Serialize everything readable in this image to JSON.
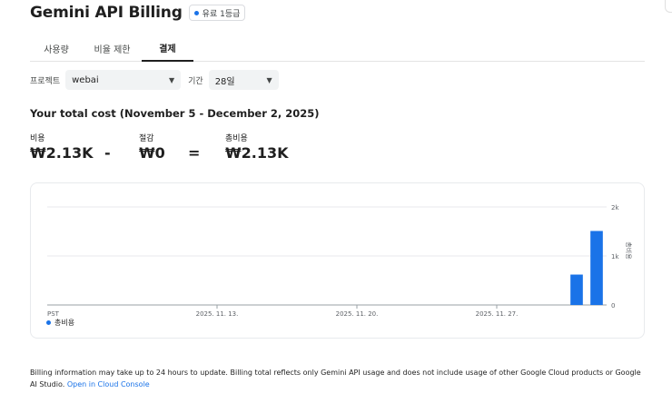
{
  "header": {
    "title": "Gemini API Billing",
    "tier_badge": "유료 1등급"
  },
  "tabs": [
    {
      "label": "사용량",
      "active": false
    },
    {
      "label": "비율 제한",
      "active": false
    },
    {
      "label": "결제",
      "active": true
    }
  ],
  "filters": {
    "project_label": "프로젝트",
    "project_value": "webai",
    "period_label": "기간",
    "period_value": "28일"
  },
  "summary": {
    "heading": "Your total cost (November 5 - December 2, 2025)",
    "cost_label": "비용",
    "cost_value": "₩2.13K",
    "minus": "-",
    "savings_label": "절감",
    "savings_value": "₩0",
    "equals": "=",
    "total_label": "총비용",
    "total_value": "₩2.13K"
  },
  "chart_data": {
    "type": "bar",
    "x": [
      "2025-11-05",
      "2025-11-06",
      "2025-11-07",
      "2025-11-08",
      "2025-11-09",
      "2025-11-10",
      "2025-11-11",
      "2025-11-12",
      "2025-11-13",
      "2025-11-14",
      "2025-11-15",
      "2025-11-16",
      "2025-11-17",
      "2025-11-18",
      "2025-11-19",
      "2025-11-20",
      "2025-11-21",
      "2025-11-22",
      "2025-11-23",
      "2025-11-24",
      "2025-11-25",
      "2025-11-26",
      "2025-11-27",
      "2025-11-28",
      "2025-11-29",
      "2025-11-30",
      "2025-12-01",
      "2025-12-02"
    ],
    "values": [
      0,
      0,
      0,
      0,
      0,
      0,
      0,
      0,
      0,
      0,
      0,
      0,
      0,
      0,
      0,
      0,
      0,
      0,
      0,
      0,
      0,
      0,
      0,
      0,
      0,
      0,
      620,
      1510
    ],
    "x_tick_labels": [
      "PST",
      "2025. 11. 13.",
      "2025. 11. 20.",
      "2025. 11. 27."
    ],
    "y_tick_labels": [
      "2k",
      "1k",
      "0"
    ],
    "ylim": [
      0,
      2000
    ],
    "ylabel": "총비용",
    "legend": [
      {
        "name": "총비용",
        "color": "#1a73e8"
      }
    ],
    "legend_position": "bottom-left",
    "grid": true,
    "bar_color": "#1a73e8"
  },
  "footer": {
    "text": "Billing information may take up to 24 hours to update. Billing total reflects only Gemini API usage and does not include usage of other Google Cloud products or Google AI Studio.",
    "link": "Open in Cloud Console"
  }
}
